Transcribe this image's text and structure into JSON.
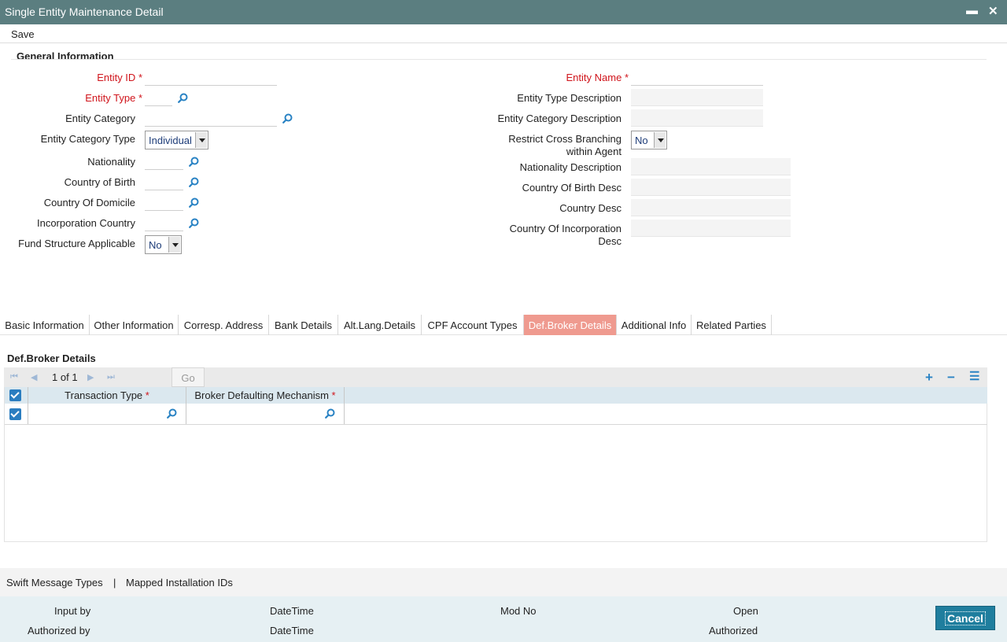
{
  "window": {
    "title": "Single Entity Maintenance Detail",
    "minimize": "▬",
    "close": "✕"
  },
  "toolbar": {
    "save_label": "Save"
  },
  "general": {
    "title": "General Information",
    "entity_id": {
      "label": "Entity ID",
      "value": ""
    },
    "entity_type": {
      "label": "Entity Type",
      "value": ""
    },
    "entity_category": {
      "label": "Entity Category",
      "value": ""
    },
    "entity_category_type": {
      "label": "Entity Category Type",
      "value": "Individual"
    },
    "nationality": {
      "label": "Nationality",
      "value": ""
    },
    "country_of_birth": {
      "label": "Country of Birth",
      "value": ""
    },
    "country_of_domicile": {
      "label": "Country Of Domicile",
      "value": ""
    },
    "incorporation_country": {
      "label": "Incorporation Country",
      "value": ""
    },
    "fund_structure": {
      "label": "Fund Structure Applicable",
      "value": "No"
    },
    "entity_name": {
      "label": "Entity Name",
      "value": ""
    },
    "entity_type_desc": {
      "label": "Entity Type Description",
      "value": ""
    },
    "entity_category_desc": {
      "label": "Entity Category Description",
      "value": ""
    },
    "restrict_cross": {
      "label_line1": "Restrict Cross Branching",
      "label_line2": "within Agent",
      "value": "No"
    },
    "nationality_desc": {
      "label": "Nationality Description",
      "value": ""
    },
    "country_birth_desc": {
      "label": "Country Of Birth Desc",
      "value": ""
    },
    "country_desc": {
      "label": "Country Desc",
      "value": ""
    },
    "country_incorp_desc": {
      "label_line1": "Country Of Incorporation",
      "label_line2": "Desc",
      "value": ""
    },
    "required_mark": "*"
  },
  "tabs": [
    {
      "label": "Basic Information"
    },
    {
      "label": "Other Information"
    },
    {
      "label": "Corresp. Address"
    },
    {
      "label": "Bank Details"
    },
    {
      "label": "Alt.Lang.Details"
    },
    {
      "label": "CPF Account Types"
    },
    {
      "label": "Def.Broker Details"
    },
    {
      "label": "Additional Info"
    },
    {
      "label": "Related Parties"
    }
  ],
  "active_tab": "Def.Broker Details",
  "grid": {
    "title": "Def.Broker Details",
    "pager": {
      "page": "1",
      "of_label": "of",
      "total": "1"
    },
    "go_label": "Go",
    "columns": [
      {
        "label": "Transaction Type",
        "required": "*"
      },
      {
        "label": "Broker Defaulting Mechanism",
        "required": "*"
      }
    ],
    "rows": [
      {
        "transaction_type": "",
        "broker_mechanism": "",
        "checked": true
      }
    ]
  },
  "sublinks": {
    "swift": "Swift Message Types",
    "separator": "|",
    "mapped": "Mapped Installation IDs"
  },
  "footer": {
    "input_by": "Input by",
    "datetime1": "DateTime",
    "mod_no": "Mod No",
    "open": "Open",
    "authorized_by": "Authorized by",
    "datetime2": "DateTime",
    "authorized": "Authorized",
    "cancel_label": "Cancel"
  },
  "colors": {
    "titlebar": "#5b7e80",
    "active_tab": "#ef9a8f",
    "accent": "#2a83c4",
    "required": "#d0141b",
    "cancel_button": "#1f7e9e"
  },
  "icons": {
    "lookup": "magnifier-icon",
    "add": "plus-icon",
    "delete": "minus-icon",
    "view": "list-icon"
  }
}
